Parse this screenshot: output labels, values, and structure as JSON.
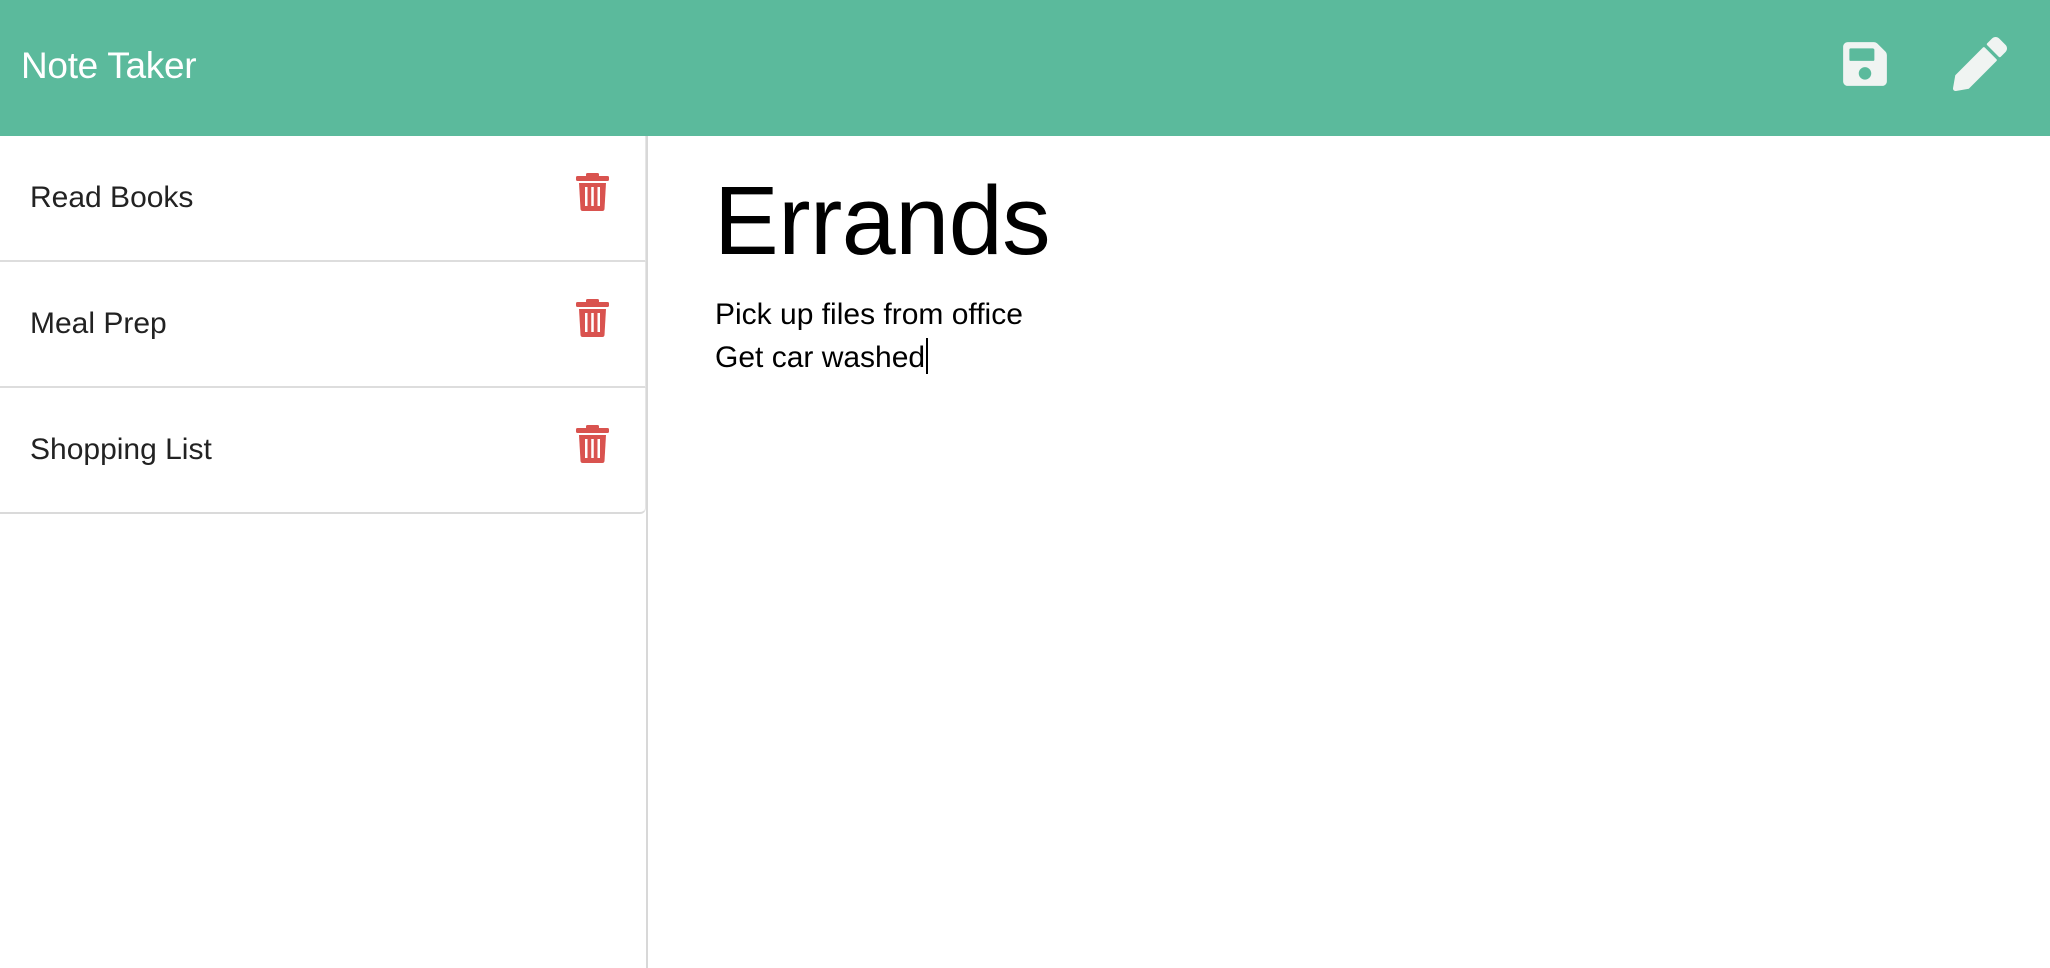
{
  "header": {
    "title": "Note Taker",
    "icons": [
      "save-icon",
      "pencil-icon"
    ],
    "background_color": "#5bba9c"
  },
  "sidebar": {
    "notes": [
      {
        "title": "Read Books",
        "icon": "trash-icon"
      },
      {
        "title": "Meal Prep",
        "icon": "trash-icon"
      },
      {
        "title": "Shopping List",
        "icon": "trash-icon"
      }
    ],
    "delete_icon_color": "#d9534f"
  },
  "editor": {
    "title": "Errands",
    "body_lines": [
      "Pick up files from office",
      "Get car washed"
    ]
  }
}
